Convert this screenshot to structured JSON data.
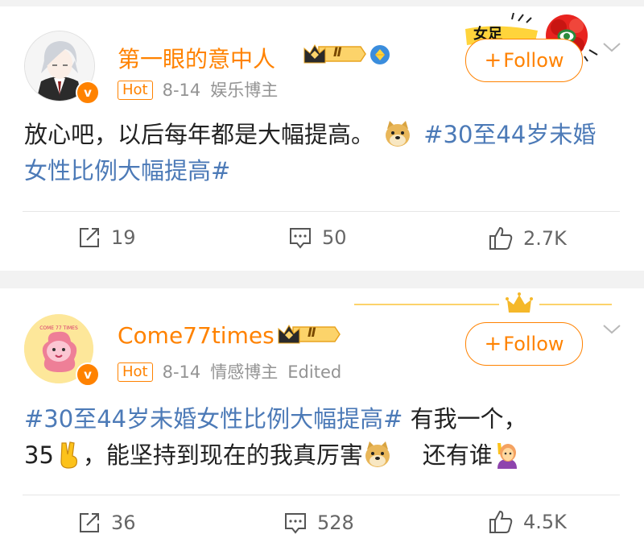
{
  "posts": [
    {
      "user": {
        "name": "第一眼的意中人",
        "crown_level": "Ⅱ"
      },
      "hot_label": "Hot",
      "date": "8-14",
      "category": "娱乐博主",
      "edited": "",
      "follow_label": "Follow",
      "sticker_text": "女足",
      "content": {
        "text": "放心吧，以后每年都是大幅提高。",
        "topic": "#30至44岁未婚女性比例大幅提高#"
      },
      "actions": {
        "repost": "19",
        "comment": "50",
        "like": "2.7K"
      }
    },
    {
      "user": {
        "name": "Come77times",
        "crown_level": "Ⅱ"
      },
      "avatar_text": "COME 77 TIMES",
      "hot_label": "Hot",
      "date": "8-14",
      "category": "情感博主",
      "edited": "Edited",
      "follow_label": "Follow",
      "content": {
        "topic": "#30至44岁未婚女性比例大幅提高#",
        "text_a": " 有我一个，",
        "text_b": "35",
        "text_c": "，能坚持到现在的我真厉害",
        "text_d": "还有谁"
      },
      "actions": {
        "repost": "36",
        "comment": "528",
        "like": "4.5K"
      }
    }
  ],
  "icons": [
    "crown-icon",
    "verified-v-icon",
    "diamond-badge-icon",
    "doge-emoji",
    "victory-hand-emoji",
    "raising-hand-emoji",
    "repost-icon",
    "comment-icon",
    "like-icon",
    "chevron-down-icon"
  ],
  "colors": {
    "accent": "#ff8200",
    "topic": "#4c7ab7",
    "meta": "#939393",
    "text": "#222222",
    "background": "#f2f2f2"
  }
}
